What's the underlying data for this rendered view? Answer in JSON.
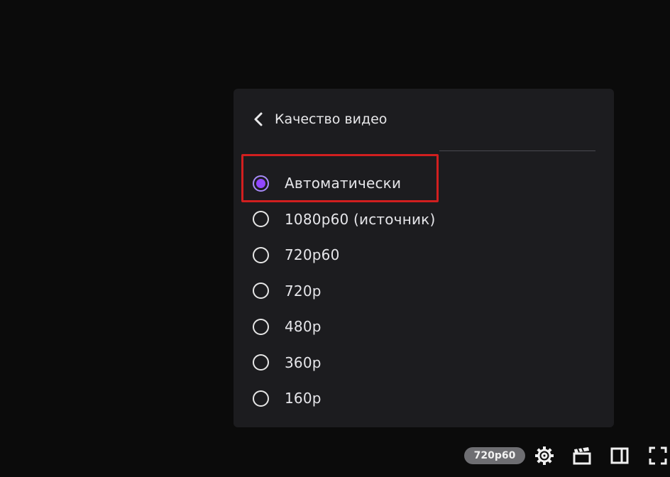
{
  "menu": {
    "title": "Качество видео",
    "selected_index": 0,
    "options": [
      {
        "label": "Автоматически",
        "selected": true
      },
      {
        "label": "1080p60 (источник)",
        "selected": false
      },
      {
        "label": "720p60",
        "selected": false
      },
      {
        "label": "720p",
        "selected": false
      },
      {
        "label": "480p",
        "selected": false
      },
      {
        "label": "360p",
        "selected": false
      },
      {
        "label": "160p",
        "selected": false
      }
    ]
  },
  "player_controls": {
    "quality_badge": "720p60",
    "icons": [
      "settings-gear-icon",
      "clip-icon",
      "theatre-mode-icon",
      "fullscreen-icon"
    ]
  },
  "colors": {
    "accent": "#9147ff",
    "highlight_border": "#d11f1f",
    "menu_bg": "#1c1c1f"
  }
}
